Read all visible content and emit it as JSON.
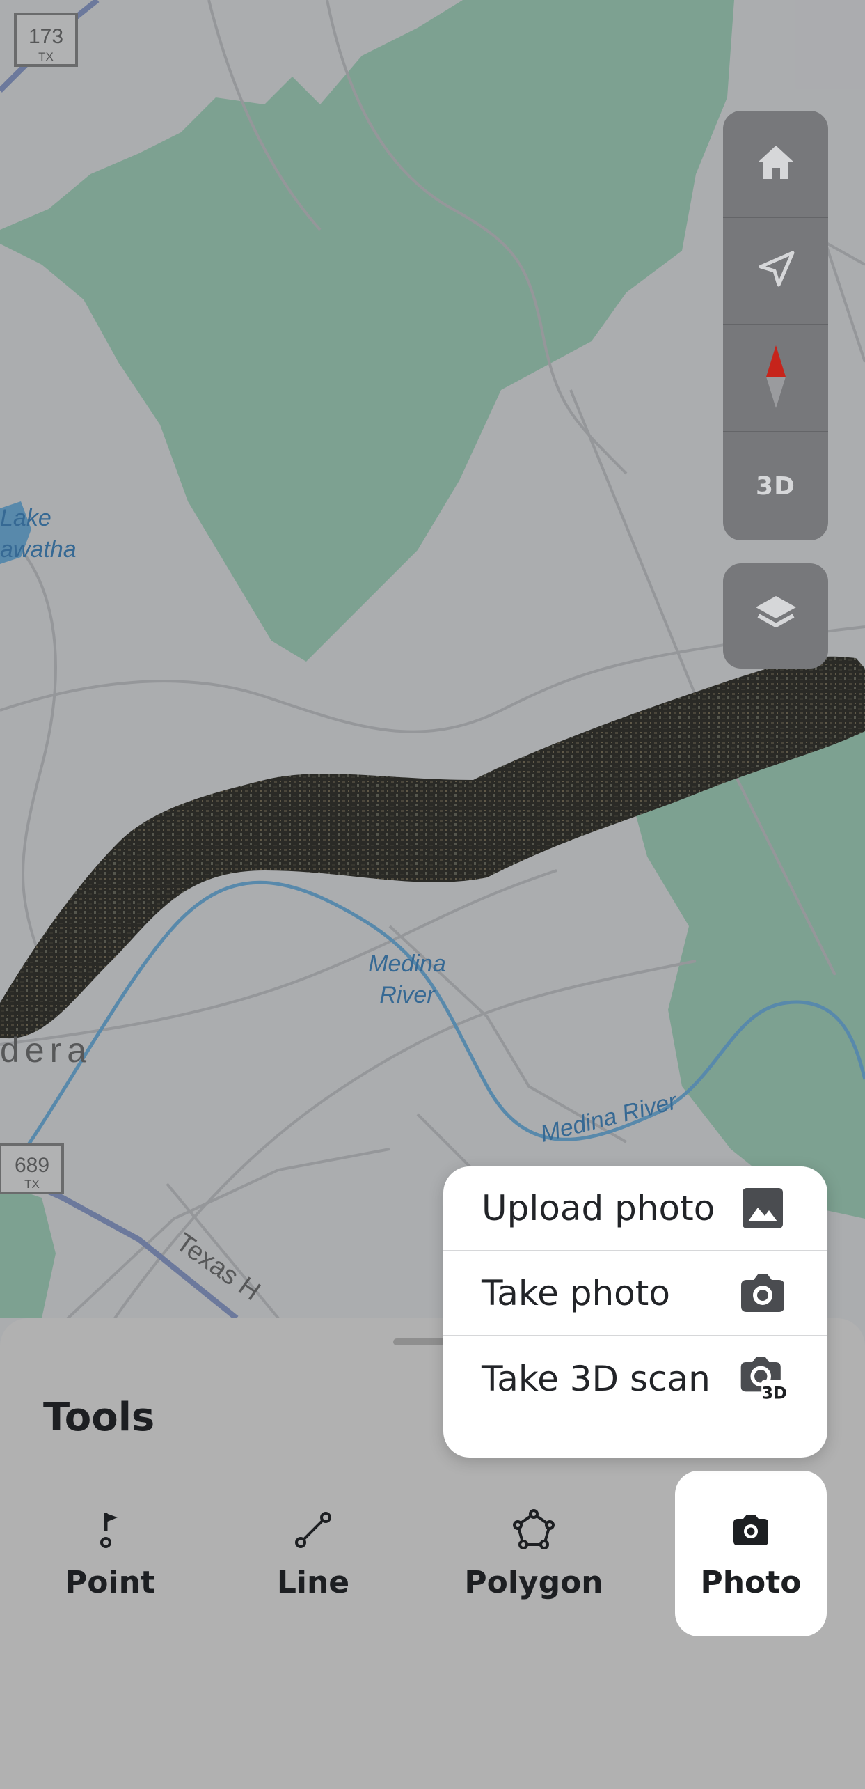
{
  "map": {
    "labels": {
      "highway_173": "173",
      "highway_173_state": "TX",
      "highway_689": "689",
      "highway_689_state": "TX",
      "lake_line1": "Lake",
      "lake_line2": "awatha",
      "river_line1": "Medina",
      "river_line2": "River",
      "river_curved": "Medina River",
      "town_partial": "dera",
      "road_partial": "Texas H"
    },
    "colors": {
      "land": "#e9eaec",
      "park": "#a6d9c0",
      "water": "#6fb6e6",
      "road": "#c9cacd"
    }
  },
  "map_controls": {
    "home_icon": "home-icon",
    "locate_icon": "navigation-arrow-icon",
    "compass_icon": "compass-icon",
    "three_d_label": "3D",
    "layers_icon": "layers-icon"
  },
  "photo_menu": {
    "items": [
      {
        "label": "Upload photo",
        "icon": "image-icon"
      },
      {
        "label": "Take photo",
        "icon": "camera-icon"
      },
      {
        "label": "Take 3D scan",
        "icon": "camera-3d-icon",
        "badge": "3D"
      }
    ]
  },
  "tools_sheet": {
    "title": "Tools",
    "tools": [
      {
        "label": "Point",
        "icon": "point-flag-icon"
      },
      {
        "label": "Line",
        "icon": "line-icon"
      },
      {
        "label": "Polygon",
        "icon": "polygon-icon"
      },
      {
        "label": "Photo",
        "icon": "camera-icon",
        "selected": true
      }
    ]
  }
}
